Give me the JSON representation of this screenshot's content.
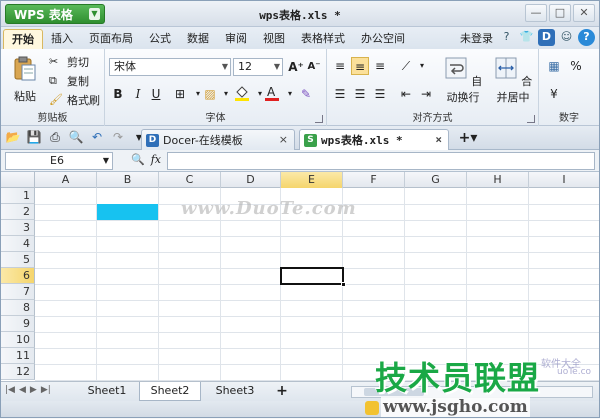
{
  "app": {
    "button_label": "WPS 表格",
    "window_title": "wps表格.xls *"
  },
  "window_controls": [
    "—",
    "□",
    "✕"
  ],
  "menu": {
    "tabs": [
      "开始",
      "插入",
      "页面布局",
      "公式",
      "数据",
      "审阅",
      "视图",
      "表格样式",
      "办公空间"
    ],
    "active_tab": "开始",
    "login": "未登录",
    "right_icons": [
      "shirt-icon",
      "d-icon",
      "user-icon",
      "help-icon"
    ]
  },
  "ribbon": {
    "clipboard": {
      "paste": "粘贴",
      "cut": "剪切",
      "copy": "复制",
      "format_painter": "格式刷",
      "group": "剪贴板"
    },
    "font": {
      "name": "宋体",
      "size": "12",
      "bold": "B",
      "italic": "I",
      "underline": "U",
      "group": "字体"
    },
    "alignment": {
      "wrap": "自动换行",
      "merge": "合并居中",
      "group": "对齐方式"
    },
    "number": {
      "percent": "%",
      "group": "数字"
    }
  },
  "doc_tabs": [
    {
      "label": "Docer-在线模板",
      "icon": "D"
    },
    {
      "label": "wps表格.xls *",
      "icon": "S"
    }
  ],
  "formula_bar": {
    "cell_ref": "E6",
    "fx": "fx"
  },
  "columns": [
    "A",
    "B",
    "C",
    "D",
    "E",
    "F",
    "G",
    "H",
    "I"
  ],
  "rows": [
    "1",
    "2",
    "3",
    "4",
    "5",
    "6",
    "7",
    "8",
    "9",
    "10",
    "11",
    "12"
  ],
  "selected_cell": {
    "col": "E",
    "row": "6"
  },
  "filled_cell": {
    "col": "B",
    "row": "2",
    "color": "#17c2f0"
  },
  "watermark": "www.DuoTe.com",
  "sheets": [
    "Sheet1",
    "Sheet2",
    "Sheet3"
  ],
  "active_sheet": "Sheet2",
  "logo": {
    "title": "技术员联盟",
    "url": "www.jsgho.com",
    "faint1": "软件大全",
    "faint2": "uoTe.co"
  },
  "colors": {
    "accent_green": "#2f8f2f",
    "selection": "#f5d56c",
    "fill": "#17c2f0"
  }
}
